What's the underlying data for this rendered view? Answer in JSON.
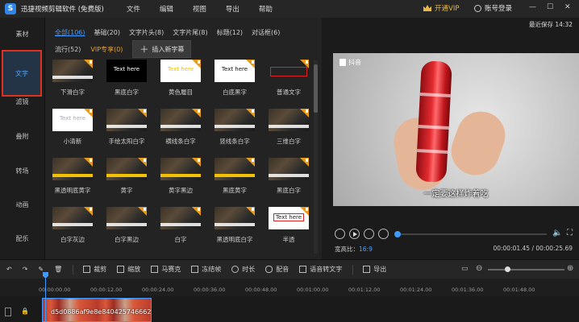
{
  "app": {
    "title": "迅捷视频剪辑软件 (免费版)",
    "logo_letter": "S"
  },
  "menu": [
    "文件",
    "编辑",
    "视图",
    "导出",
    "帮助"
  ],
  "header": {
    "vip": "开通VIP",
    "account": "账号登录",
    "save_time": "最近保存 14:32"
  },
  "window_controls": [
    "—",
    "☐",
    "✕"
  ],
  "sidebar": [
    {
      "label": "素材"
    },
    {
      "label": "文字",
      "active": true
    },
    {
      "label": "滤镜"
    },
    {
      "label": "叠附"
    },
    {
      "label": "转场"
    },
    {
      "label": "动画"
    },
    {
      "label": "配乐"
    }
  ],
  "library": {
    "tabs": [
      "全部(106)",
      "基础(20)",
      "文字片头(8)",
      "文字片尾(8)",
      "标题(12)",
      "对话框(6)"
    ],
    "tab2": [
      "流行(52)",
      "VIP专享(0)"
    ],
    "add_button": "插入新字幕",
    "tiles": [
      {
        "label": "下滑白字",
        "style": "video"
      },
      {
        "label": "黑底白字",
        "style": "dark",
        "text": "Text here"
      },
      {
        "label": "黄色履目",
        "style": "white-yellow",
        "text": "Text here"
      },
      {
        "label": "白底黑字",
        "style": "white",
        "text": "Text here"
      },
      {
        "label": "普通文字",
        "style": "redbox"
      },
      {
        "label": "小清新",
        "style": "white-light",
        "text": "Text here"
      },
      {
        "label": "手绘太阳白字",
        "style": "video"
      },
      {
        "label": "横线条白字",
        "style": "video"
      },
      {
        "label": "竖线条白字",
        "style": "video"
      },
      {
        "label": "三维白字",
        "style": "video"
      },
      {
        "label": "黑透明底黄字",
        "style": "video"
      },
      {
        "label": "黄字",
        "style": "video"
      },
      {
        "label": "黄字黑边",
        "style": "video"
      },
      {
        "label": "黑底黄字",
        "style": "video"
      },
      {
        "label": "黑底白字",
        "style": "video"
      },
      {
        "label": "白字灰边",
        "style": "video"
      },
      {
        "label": "白字黑边",
        "style": "video"
      },
      {
        "label": "白字",
        "style": "video"
      },
      {
        "label": "黑透明底白字",
        "style": "video"
      },
      {
        "label": "半透",
        "style": "white-red",
        "text": "Text here"
      }
    ]
  },
  "preview": {
    "tiktok": "抖音",
    "subtitle": "一定要这样炸着吃",
    "ratio_label": "宽高比：",
    "ratio_value": "16:9",
    "time": "00:00:01.45 / 00:00:25.69",
    "progress": 0.0
  },
  "toolbar": [
    "裁剪",
    "缩放",
    "马赛克",
    "冻结帧",
    "时长",
    "配音",
    "语音转文字",
    "导出"
  ],
  "timeline": {
    "ticks": [
      "00:00:00.00",
      "00:00:12.00",
      "00:00:24.00",
      "00:00:36.00",
      "00:00:48.00",
      "00:01:00.00",
      "00:01:12.00",
      "00:01:24.00",
      "00:01:36.00",
      "00:01:48.00"
    ],
    "clip_name": "d5d0886af9e8e840425746662..."
  }
}
